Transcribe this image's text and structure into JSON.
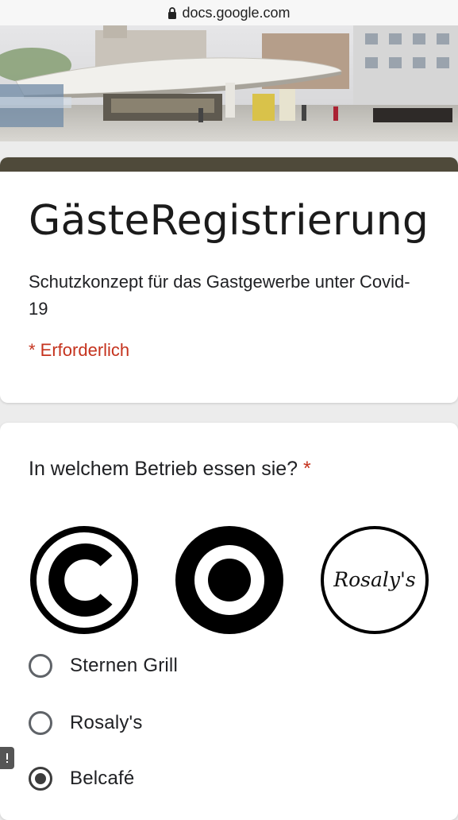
{
  "browser": {
    "url": "docs.google.com"
  },
  "form": {
    "title": "GästeRegistrierung",
    "description": "Schutzkonzept für das Gastgewerbe unter Covid-19",
    "required_note": "* Erforderlich",
    "header_color": "#4f4a3a"
  },
  "question": {
    "title": "In welchem Betrieb essen sie?",
    "required_star": "*",
    "logos": [
      {
        "icon": "c-logo-icon"
      },
      {
        "icon": "target-logo-icon"
      },
      {
        "icon": "rosalys-logo-icon",
        "text": "Rosaly's"
      }
    ],
    "options": [
      {
        "label": "Sternen Grill",
        "selected": false
      },
      {
        "label": "Rosaly's",
        "selected": false
      },
      {
        "label": "Belcafé",
        "selected": true
      }
    ]
  },
  "colors": {
    "required": "#c5331e",
    "background": "#ececec"
  }
}
